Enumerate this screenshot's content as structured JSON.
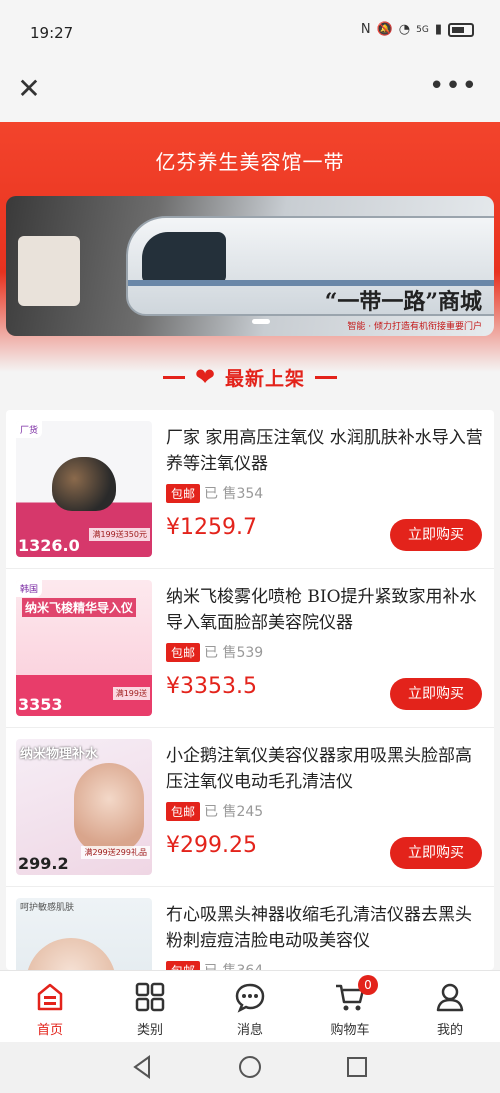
{
  "status_bar": {
    "time": "19:27",
    "signal_label": "5G"
  },
  "header": {
    "title": "亿芬养生美容馆一带"
  },
  "banner": {
    "slogan": "“一带一路”商城",
    "subtitle": "智能 · 倾力打造有机衔接重要门户"
  },
  "section": {
    "title": "最新上架"
  },
  "products": [
    {
      "name": "厂家 家用高压注氧仪 水润肌肤补水导入营养等注氧仪器",
      "free_label": "包邮",
      "sold": "已 售354",
      "price": "¥1259.7",
      "buy_label": "立即购买",
      "thumb": {
        "badge": "厂货",
        "price_tag": "1326.0",
        "promo": "满199送350元"
      }
    },
    {
      "name": "纳米飞梭雾化喷枪 BIO提升紧致家用补水导入氧面脸部美容院仪器",
      "free_label": "包邮",
      "sold": "已 售539",
      "price": "¥3353.5",
      "buy_label": "立即购买",
      "thumb": {
        "badge": "韩国",
        "heading": "纳米飞梭精华导入仪",
        "price_tag": "3353",
        "promo": "满199送"
      }
    },
    {
      "name": "小企鹅注氧仪美容仪器家用吸黑头脸部高压注氧仪电动毛孔清洁仪",
      "free_label": "包邮",
      "sold": "已 售245",
      "price": "¥299.25",
      "buy_label": "立即购买",
      "thumb": {
        "heading": "纳米物理补水",
        "price_tag": "299.2",
        "promo": "满299送299礼品"
      }
    },
    {
      "name": "冇心吸黑头神器收缩毛孔清洁仪器去黑头粉刺痘痘洁脸电动吸美容仪",
      "free_label": "包邮",
      "sold": "已 售364",
      "price": "",
      "buy_label": "",
      "thumb": {
        "heading": "呵护敏感肌肤"
      }
    }
  ],
  "bottom_nav": [
    {
      "label": "首页",
      "icon": "home-icon",
      "active": true
    },
    {
      "label": "类别",
      "icon": "category-grid-icon",
      "active": false
    },
    {
      "label": "消息",
      "icon": "message-icon",
      "active": false
    },
    {
      "label": "购物车",
      "icon": "cart-icon",
      "active": false,
      "badge": "0"
    },
    {
      "label": "我的",
      "icon": "profile-icon",
      "active": false
    }
  ],
  "colors": {
    "accent": "#e3231b",
    "header": "#f3442c"
  }
}
